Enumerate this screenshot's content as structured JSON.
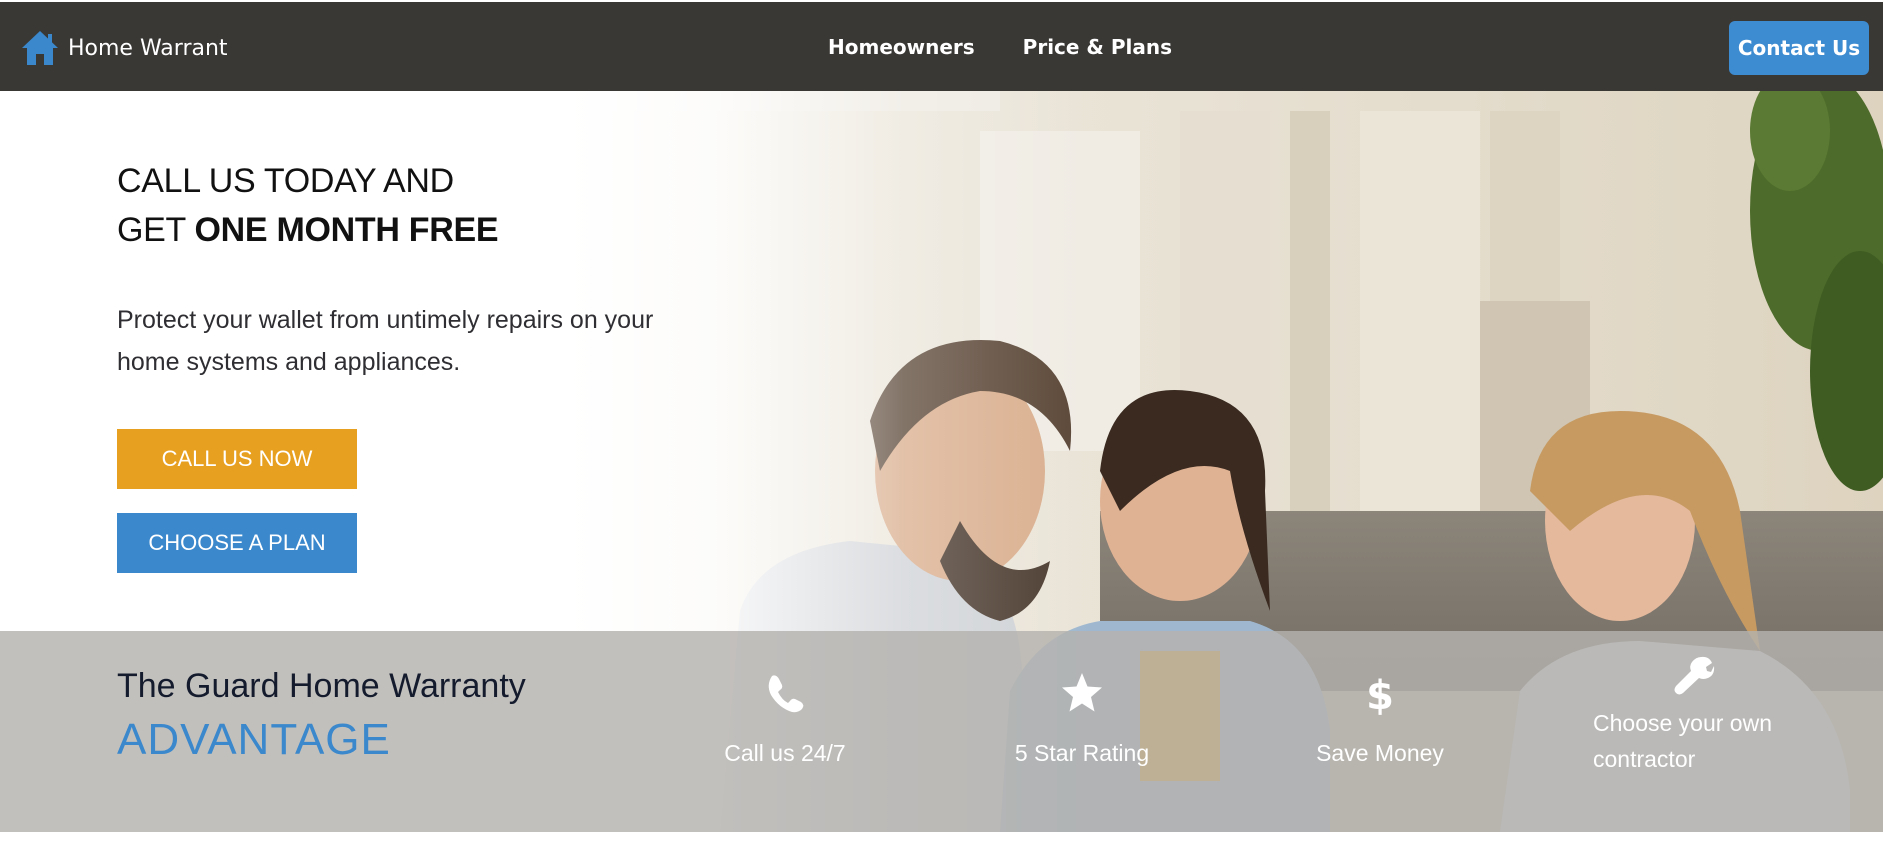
{
  "navbar": {
    "brand_text": "Home Warrant",
    "brand_icon": "house-icon",
    "links": [
      "Homeowners",
      "Price & Plans"
    ],
    "contact_label": "Contact Us"
  },
  "hero": {
    "headline_line1": "CALL US TODAY AND",
    "headline_line2_prefix": "GET ",
    "headline_line2_bold": "ONE MONTH FREE",
    "subtext": "Protect your wallet from untimely repairs on your home systems and appliances.",
    "call_button": "CALL US NOW",
    "plan_button": "CHOOSE A PLAN"
  },
  "advantage": {
    "title": "The Guard Home Warranty",
    "word": "ADVANTAGE",
    "features": [
      {
        "icon": "phone-icon",
        "label": "Call us 24/7"
      },
      {
        "icon": "star-icon",
        "label": "5 Star Rating"
      },
      {
        "icon": "dollar-icon",
        "label": "Save Money"
      },
      {
        "icon": "wrench-icon",
        "label": "Choose your own contractor"
      }
    ]
  },
  "colors": {
    "navbar_bg": "#3a3835",
    "accent_blue": "#3b88cc",
    "accent_orange": "#e8a020"
  }
}
